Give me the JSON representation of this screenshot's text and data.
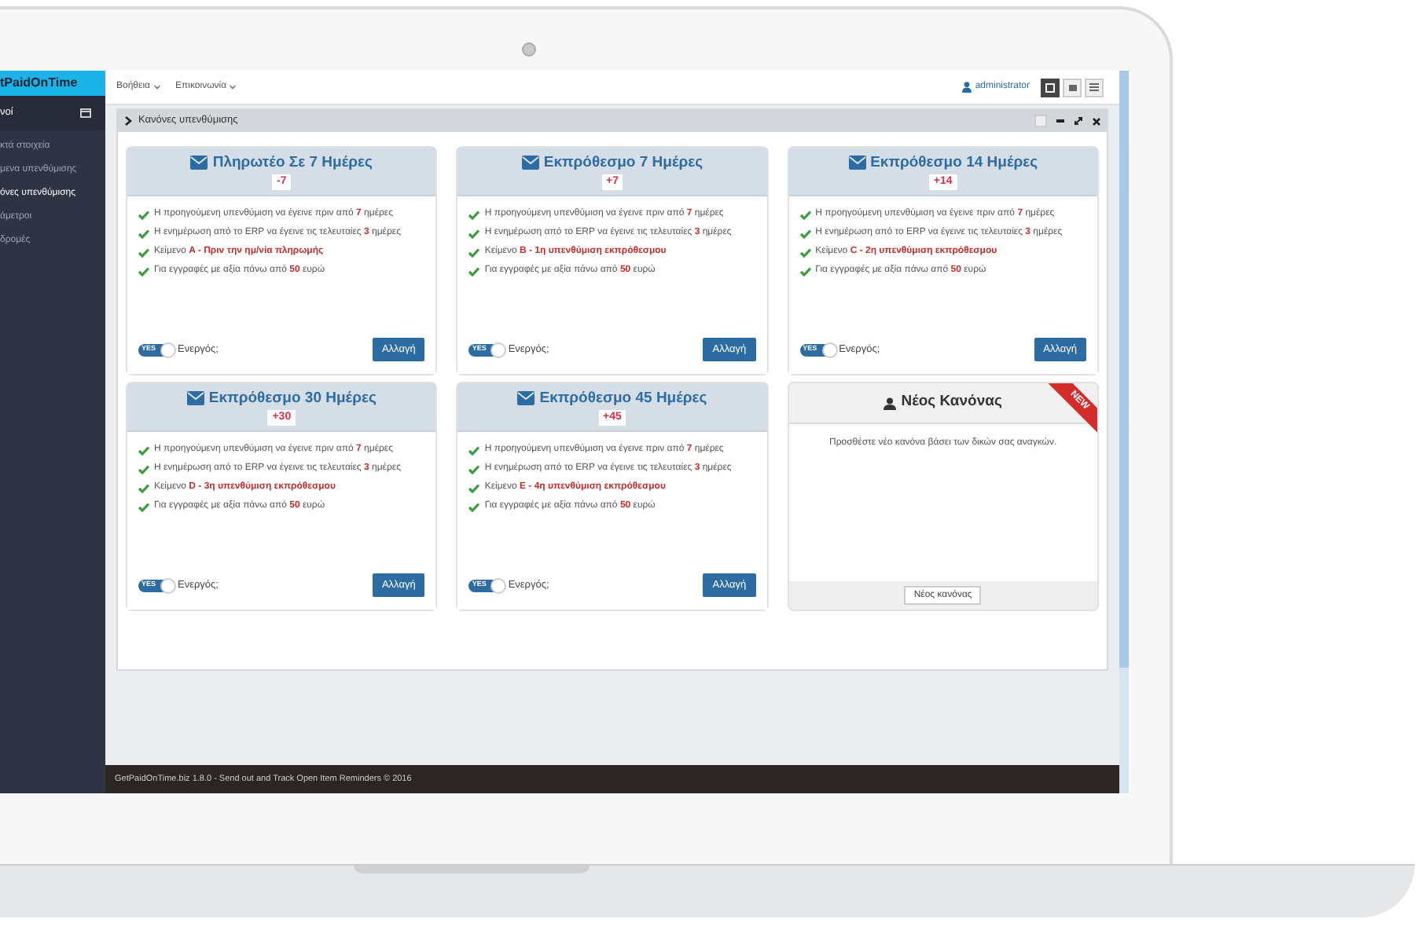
{
  "sidebar": {
    "logo": "tPaidOnTime",
    "header": "νοί",
    "items": [
      {
        "label": "κτά στοιχεία",
        "selected": false
      },
      {
        "label": "μενα υπενθύμισης",
        "selected": false
      },
      {
        "label": "όνες υπενθύμισης",
        "selected": true
      },
      {
        "label": "άμετροι",
        "selected": false
      },
      {
        "label": "δρομές",
        "selected": false
      }
    ]
  },
  "topnav": {
    "menus": [
      "Βοήθεια",
      "Επικοινωνία"
    ],
    "user": "administrator"
  },
  "panel": {
    "title": "Κανόνες υπενθύμισης"
  },
  "cards": [
    {
      "kind": "rule",
      "title": "Πληρωτέο Σε 7 Ημέρες",
      "badge": "-7",
      "rules": [
        "Η προηγούμενη υπενθύμιση να έγεινε πριν από **7** ημέρες",
        "Η ενημέρωση από το ERP να έγεινε τις τελευταίες **3** ημέρες",
        "Κείμενο **A - Πριν την ημ/νία πληρωμής**",
        "Για εγγραφές με αξία πάνω από **50** ευρώ"
      ],
      "toggle_text": "YES",
      "on": true,
      "toggle_label": "Ενεργός;",
      "button": "Αλλαγή"
    },
    {
      "kind": "rule",
      "title": "Εκπρόθεσμο 7 Ημέρες",
      "badge": "+7",
      "rules": [
        "Η προηγούμενη υπενθύμιση να έγεινε πριν από **7** ημέρες",
        "Η ενημέρωση από το ERP να έγεινε τις τελευταίες **3** ημέρες",
        "Κείμενο **B - 1η υπενθύμιση εκπρόθεσμου**",
        "Για εγγραφές με αξία πάνω από **50** ευρώ"
      ],
      "toggle_text": "YES",
      "on": true,
      "toggle_label": "Ενεργός;",
      "button": "Αλλαγή"
    },
    {
      "kind": "rule",
      "title": "Εκπρόθεσμο 14 Ημέρες",
      "badge": "+14",
      "rules": [
        "Η προηγούμενη υπενθύμιση να έγεινε πριν από **7** ημέρες",
        "Η ενημέρωση από το ERP να έγεινε τις τελευταίες **3** ημέρες",
        "Κείμενο **C - 2η υπενθύμιση εκπρόθεσμου**",
        "Για εγγραφές με αξία πάνω από **50** ευρώ"
      ],
      "toggle_text": "YES",
      "on": true,
      "toggle_label": "Ενεργός;",
      "button": "Αλλαγή"
    },
    {
      "kind": "rule",
      "title": "Εκπρόθεσμο 30 Ημέρες",
      "badge": "+30",
      "rules": [
        "Η προηγούμενη υπενθύμιση να έγεινε πριν από **7** ημέρες",
        "Η ενημέρωση από το ERP να έγεινε τις τελευταίες **3** ημέρες",
        "Κείμενο **D - 3η υπενθύμιση εκπρόθεσμου**",
        "Για εγγραφές με αξία πάνω από **50** ευρώ"
      ],
      "toggle_text": "YES",
      "on": true,
      "toggle_label": "Ενεργός;",
      "button": "Αλλαγή"
    },
    {
      "kind": "rule",
      "title": "Εκπρόθεσμο 45 Ημέρες",
      "badge": "+45",
      "rules": [
        "Η προηγούμενη υπενθύμιση να έγεινε πριν από **7** ημέρες",
        "Η ενημέρωση από το ERP να έγεινε τις τελευταίες **3** ημέρες",
        "Κείμενο **E - 4η υπενθύμιση εκπρόθεσμου**",
        "Για εγγραφές με αξία πάνω από **50** ευρώ"
      ],
      "toggle_text": "YES",
      "on": true,
      "toggle_label": "Ενεργός;",
      "button": "Αλλαγή"
    },
    {
      "kind": "new",
      "title": "Νέος Κανόνας",
      "ribbon": "NEW",
      "text": "Προσθέστε νέο κανόνα βάσει των δικών σας αναγκών.",
      "button": "Νέος κανόνας"
    }
  ],
  "footer": "GetPaidOnTime.biz 1.8.0 - Send out and Track Open Item Reminders © 2016"
}
